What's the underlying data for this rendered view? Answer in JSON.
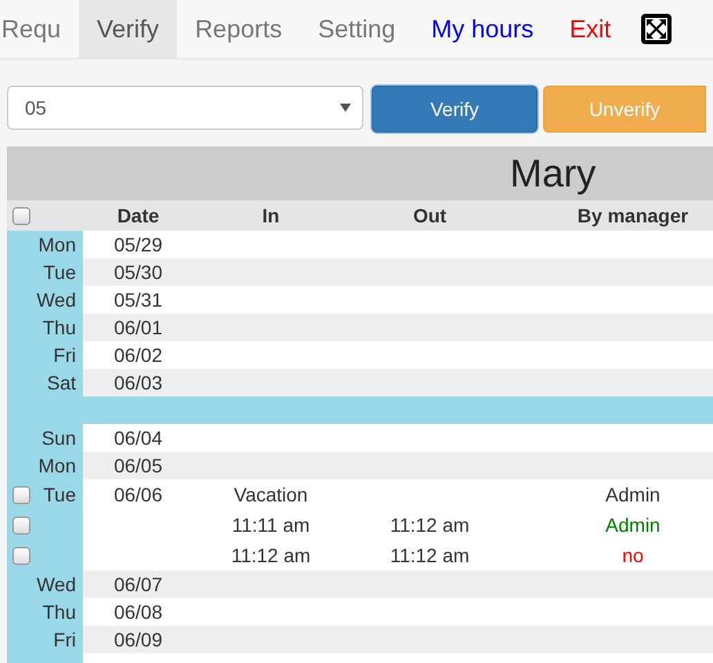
{
  "nav": [
    {
      "label": "Requ",
      "selected": false,
      "color": "#777777"
    },
    {
      "label": "Verify",
      "selected": true,
      "color": "#555555"
    },
    {
      "label": "Reports",
      "selected": false,
      "color": "#777777"
    },
    {
      "label": "Setting",
      "selected": false,
      "color": "#777777"
    },
    {
      "label": "My hours",
      "selected": false,
      "color": "#0000ff"
    },
    {
      "label": "Exit",
      "selected": false,
      "color": "#ff0000"
    }
  ],
  "period_select": {
    "value": "05"
  },
  "buttons": [
    {
      "label": "Verify",
      "kind": "primary"
    },
    {
      "label": "Unverify",
      "kind": "warning"
    }
  ],
  "table": {
    "title": "Mary",
    "select_all_checked": false,
    "columns": [
      "Date",
      "In",
      "Out",
      "By manager"
    ],
    "rows": [
      {
        "kind": "day",
        "day": "Mon",
        "date": "05/29"
      },
      {
        "kind": "day",
        "day": "Tue",
        "date": "05/30"
      },
      {
        "kind": "day",
        "day": "Wed",
        "date": "05/31"
      },
      {
        "kind": "day",
        "day": "Thu",
        "date": "06/01"
      },
      {
        "kind": "day",
        "day": "Fri",
        "date": "06/02"
      },
      {
        "kind": "day",
        "day": "Sat",
        "date": "06/03"
      },
      {
        "kind": "separator"
      },
      {
        "kind": "day",
        "day": "Sun",
        "date": "06/04"
      },
      {
        "kind": "day",
        "day": "Mon",
        "date": "06/05"
      },
      {
        "kind": "day",
        "day": "Tue",
        "date": "06/06",
        "entries": [
          {
            "checked": false,
            "in": "Vacation",
            "by": "Admin",
            "color": "#333333"
          },
          {
            "checked": false,
            "in": "11:11 am",
            "out": "11:12 am",
            "by": "Admin",
            "color": "#008000"
          },
          {
            "checked": false,
            "in": "11:12 am",
            "out": "11:12 am",
            "by": "no",
            "color": "#ff0000"
          }
        ]
      },
      {
        "kind": "day",
        "day": "Wed",
        "date": "06/07"
      },
      {
        "kind": "day",
        "day": "Thu",
        "date": "06/08"
      },
      {
        "kind": "day",
        "day": "Fri",
        "date": "06/09"
      }
    ]
  }
}
